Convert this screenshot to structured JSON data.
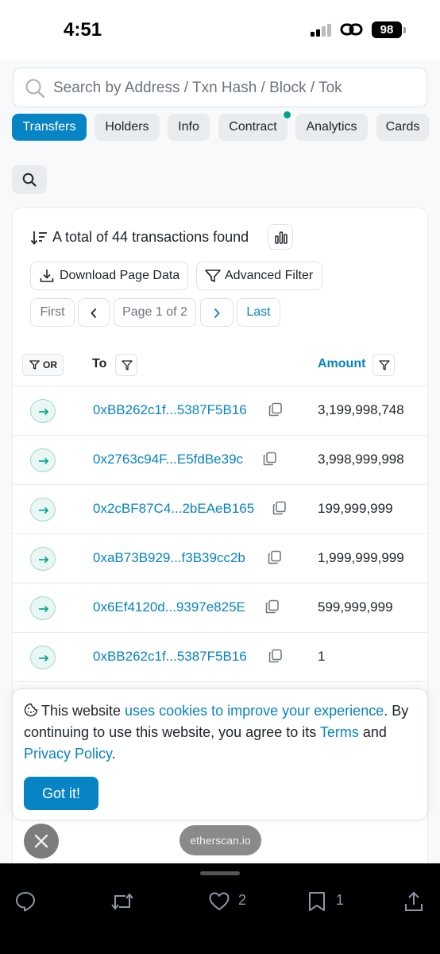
{
  "status_bar": {
    "time": "4:51",
    "battery": "98"
  },
  "search": {
    "placeholder": "Search by Address / Txn Hash / Block / Tok"
  },
  "tabs": [
    {
      "label": "Transfers",
      "active": true
    },
    {
      "label": "Holders",
      "active": false
    },
    {
      "label": "Info",
      "active": false
    },
    {
      "label": "Contract",
      "active": false
    },
    {
      "label": "Analytics",
      "active": false
    },
    {
      "label": "Cards",
      "active": false
    }
  ],
  "summary": {
    "text": "A total of 44 transactions found"
  },
  "actions": {
    "download": "Download Page Data",
    "advanced_filter": "Advanced Filter"
  },
  "pagination": {
    "first": "First",
    "page": "Page 1 of 2",
    "last": "Last"
  },
  "table": {
    "or_label": "OR",
    "col_to": "To",
    "col_amount": "Amount",
    "rows": [
      {
        "to": "0xBB262c1f...5387F5B16",
        "amount": "3,199,998,748"
      },
      {
        "to": "0x2763c94F...E5fdBe39c",
        "amount": "3,998,999,998"
      },
      {
        "to": "0x2cBF87C4...2bEAeB165",
        "amount": "199,999,999"
      },
      {
        "to": "0xaB73B929...f3B39cc2b",
        "amount": "1,999,999,999"
      },
      {
        "to": "0x6Ef4120d...9397e825E",
        "amount": "599,999,999"
      },
      {
        "to": "0xBB262c1f...5387F5B16",
        "amount": "1"
      }
    ]
  },
  "cookie": {
    "prefix": "This website ",
    "link1": "uses cookies to improve your experience",
    "middle": ". By continuing to use this website, you agree to its ",
    "link2": "Terms",
    "and": " and ",
    "link3": "Privacy Policy",
    "suffix": ".",
    "button": "Got it!"
  },
  "browser": {
    "domain": "etherscan.io"
  },
  "post_actions": {
    "likes": "2",
    "bookmarks": "1"
  },
  "colors": {
    "accent": "#0784c3",
    "success": "#00a186"
  }
}
